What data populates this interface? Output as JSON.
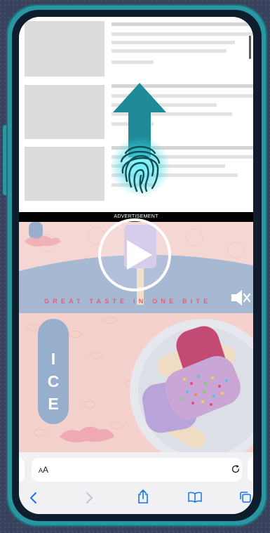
{
  "ad": {
    "label": "ADVERTISEMENT",
    "tagline": "GREAT TASTE IN ONE BITE",
    "ice_letters": [
      "I",
      "C",
      "E"
    ]
  },
  "safari": {
    "text_size_label_small": "A",
    "text_size_label_large": "A"
  },
  "icons": {
    "swipe_up": "up-arrow-icon",
    "fingerprint": "fingerprint-icon",
    "play": "play-icon",
    "mute": "speaker-muted-icon",
    "reload": "reload-icon",
    "back": "chevron-left-icon",
    "forward": "chevron-right-icon",
    "share": "share-icon",
    "bookmarks": "book-icon",
    "tabs": "tabs-icon"
  },
  "colors": {
    "phone_frame": "#2a96a3",
    "background": "#38425c",
    "safari_blue": "#1a73e8",
    "ad_pink": "#f4d7d3",
    "ad_blue": "#98aecd",
    "tagline": "#d9617e"
  }
}
